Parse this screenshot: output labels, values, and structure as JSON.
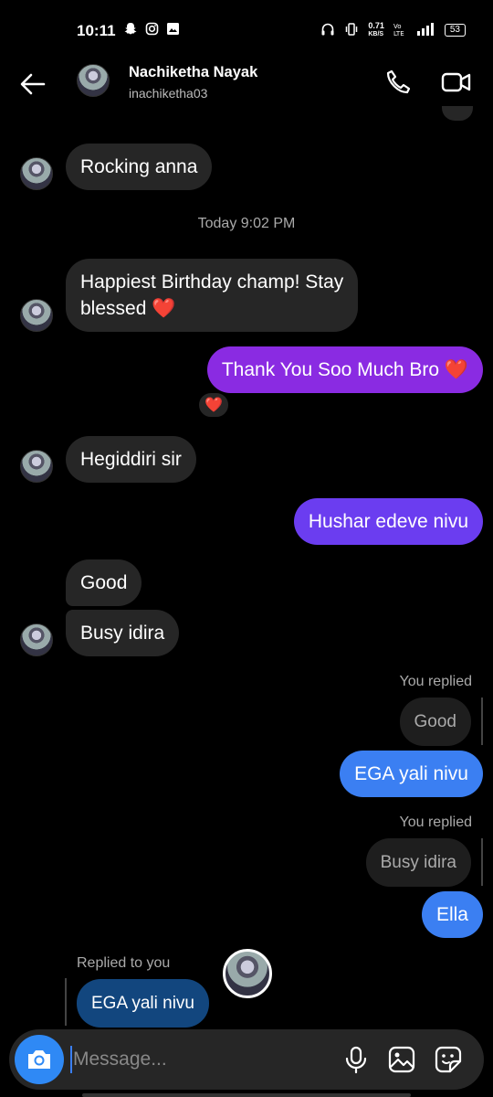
{
  "status": {
    "time": "10:11",
    "battery": "53",
    "net_speed": "0.71",
    "net_unit": "KB/S"
  },
  "header": {
    "name": "Nachiketha Nayak",
    "username": "inachiketha03"
  },
  "messages": {
    "m1": "Rocking anna",
    "timestamp": "Today 9:02 PM",
    "m2_line1": "Happiest Birthday champ! Stay",
    "m2_line2": "blessed ❤️",
    "m3": "Thank You Soo Much Bro ❤️",
    "reaction": "❤️",
    "m4": "Hegiddiri sir",
    "m5": "Hushar edeve nivu",
    "m6": "Good",
    "m7": "Busy idira",
    "reply1_label": "You replied",
    "reply1_quote": "Good",
    "m8": "EGA yali nivu",
    "reply2_label": "You replied",
    "reply2_quote": "Busy idira",
    "m9": "Ella",
    "reply3_label": "Replied to you",
    "m10": "EGA yali nivu"
  },
  "composer": {
    "placeholder": "Message..."
  },
  "colors": {
    "accent_blue": "#3b7ff2",
    "purple": "#8a2be2",
    "violet": "#6b3df0"
  }
}
